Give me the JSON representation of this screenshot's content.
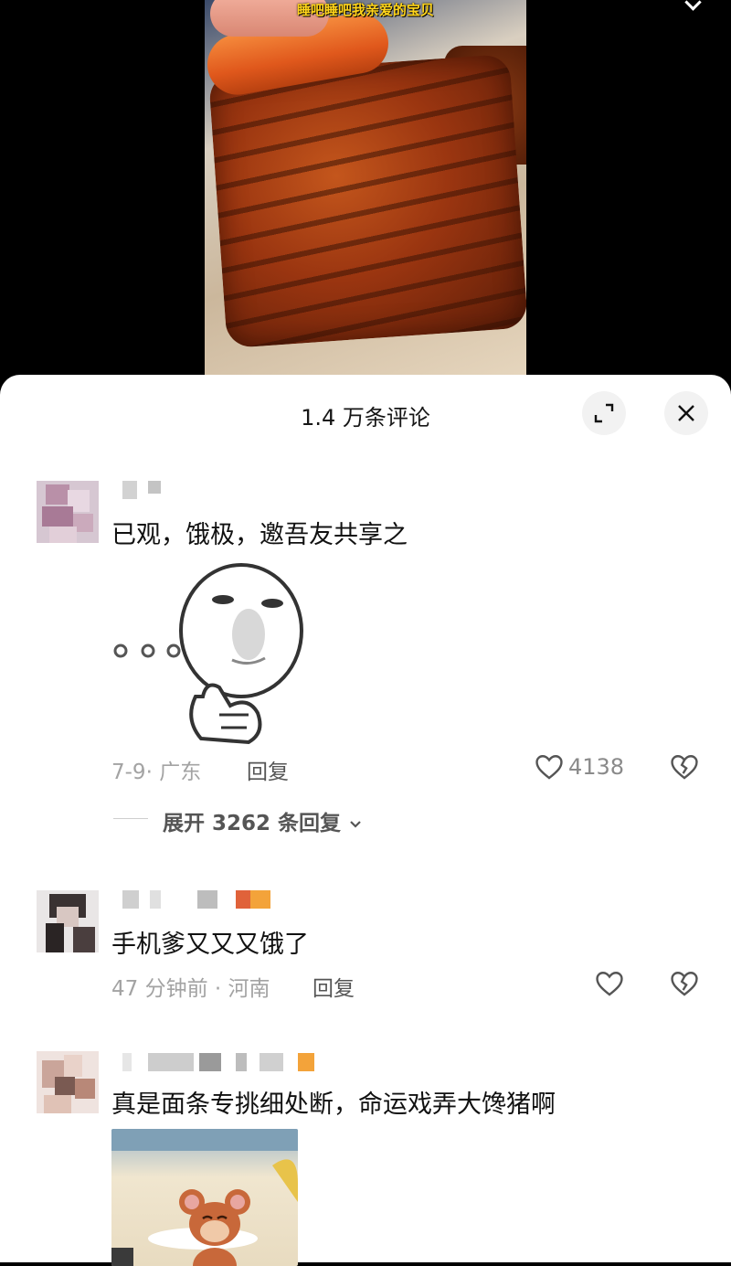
{
  "video": {
    "caption": "睡吧睡吧我亲爱的宝贝"
  },
  "sheet": {
    "title": "1.4 万条评论",
    "expand_icon": "expand-icon",
    "close_icon": "close-icon"
  },
  "comments": [
    {
      "text": "已观，饿极，邀吾友共享之",
      "sticker": "thinking-face-sticker",
      "meta": "7-9· 广东",
      "reply": "回复",
      "likes": "4138",
      "expand": "展开 3262 条回复"
    },
    {
      "text": "手机爹又又又饿了",
      "meta": "47 分钟前 · 河南",
      "reply": "回复",
      "likes": ""
    },
    {
      "text": "真是面条专挑细处断，命运戏弄大馋猪啊",
      "image": "jerry-mouse-cartoon"
    }
  ],
  "colors": {
    "caption": "#ffd41a",
    "meta": "#a3a3a3",
    "text": "#111111"
  }
}
